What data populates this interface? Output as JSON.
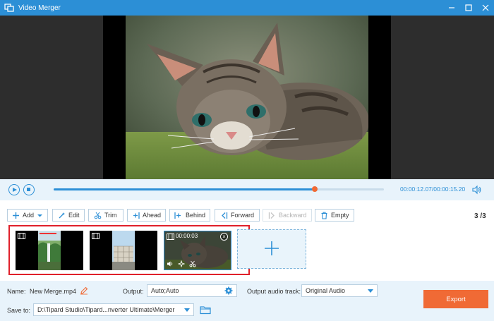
{
  "window": {
    "title": "Video Merger",
    "controls": [
      "minimize",
      "maximize",
      "close"
    ]
  },
  "playback": {
    "current_time": "00:00:12.07",
    "total_time": "/00:00:15.20",
    "progress_fraction": 0.79
  },
  "toolbar": {
    "add_label": "Add",
    "edit_label": "Edit",
    "trim_label": "Trim",
    "ahead_label": "Ahead",
    "behind_label": "Behind",
    "forward_label": "Forward",
    "backward_label": "Backward",
    "empty_label": "Empty",
    "page_counter": "3 /3"
  },
  "clips": [
    {
      "type": "video",
      "selected": false
    },
    {
      "type": "video",
      "selected": false
    },
    {
      "type": "video",
      "selected": true,
      "duration": "00:00:03"
    }
  ],
  "output": {
    "name_label": "Name:",
    "name_value": "New Merge.mp4",
    "output_label": "Output:",
    "output_value": "Auto;Auto",
    "audio_track_label": "Output audio track:",
    "audio_track_value": "Original Audio",
    "save_to_label": "Save to:",
    "save_to_value": "D:\\Tipard Studio\\Tipard...nverter Ultimate\\Merger",
    "export_label": "Export"
  },
  "colors": {
    "accent": "#2c8fd6",
    "export": "#f06a35",
    "highlight_border": "#e0202a"
  }
}
